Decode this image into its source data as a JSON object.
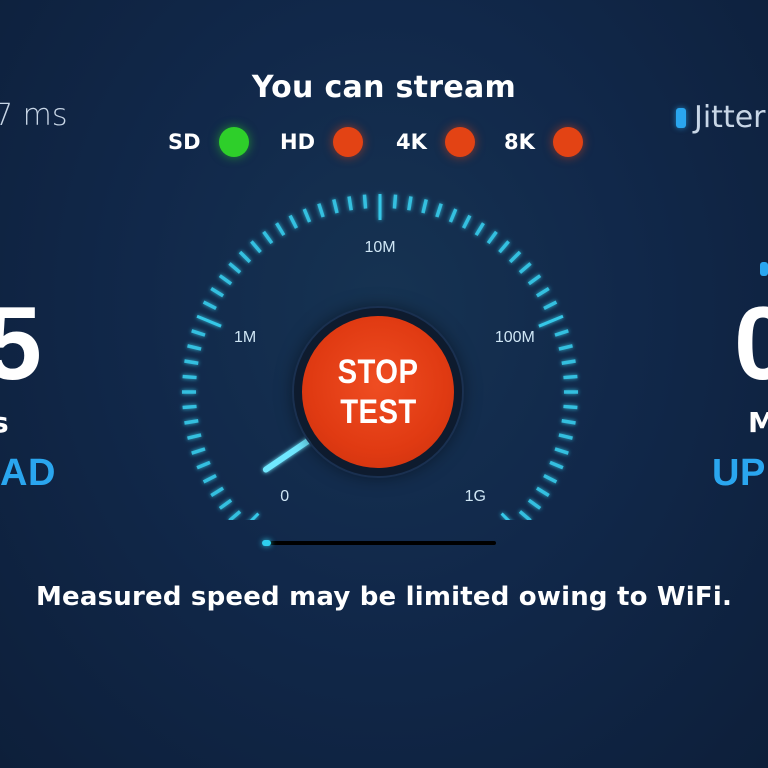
{
  "stream": {
    "title": "You can stream",
    "qualities": [
      {
        "label": "SD",
        "available": true
      },
      {
        "label": "HD",
        "available": false
      },
      {
        "label": "4K",
        "available": false
      },
      {
        "label": "8K",
        "available": false
      }
    ]
  },
  "ping": {
    "text": "7 ms"
  },
  "jitter": {
    "label": "Jitter"
  },
  "download": {
    "value": "5",
    "unit": "s",
    "label": "OAD"
  },
  "upload": {
    "value": "0",
    "unit": "M",
    "label": "UP"
  },
  "gauge": {
    "scale_labels": [
      "0",
      "1M",
      "10M",
      "100M",
      "1G"
    ],
    "needle_fraction": 0.04,
    "colors": {
      "ticks": "#36c8e8",
      "needle": "#6fe8ff"
    }
  },
  "action": {
    "label_line1": "STOP",
    "label_line2": "TEST"
  },
  "progress": {
    "fraction": 0.04
  },
  "notice": "Measured speed may be limited owing to WiFi.",
  "colors": {
    "accent": "#2aa6ef",
    "ok": "#2ecf2a",
    "bad": "#e34314",
    "button": "#e03a12"
  }
}
